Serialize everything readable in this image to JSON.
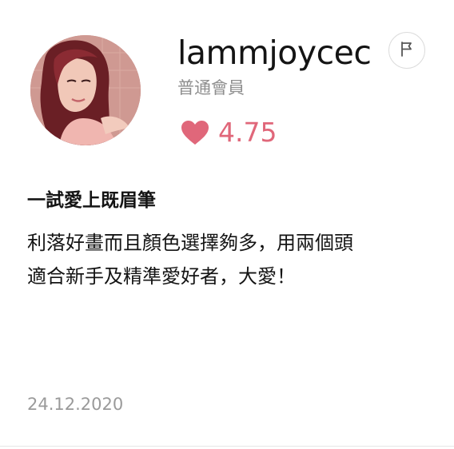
{
  "reviewer": {
    "username": "lammjoycec",
    "member_level": "普通會員",
    "avatar_icon": "user-photo-avatar"
  },
  "rating": {
    "icon": "heart-icon",
    "value": "4.75",
    "color": "#e0677a"
  },
  "actions": {
    "report_icon": "flag-icon"
  },
  "review": {
    "title": "一試愛上既眉筆",
    "body_lines": [
      "利落好畫而且顏色選擇夠多，用兩個頭",
      "適合新手及精準愛好者，大愛！"
    ],
    "date": "24.12.2020"
  }
}
